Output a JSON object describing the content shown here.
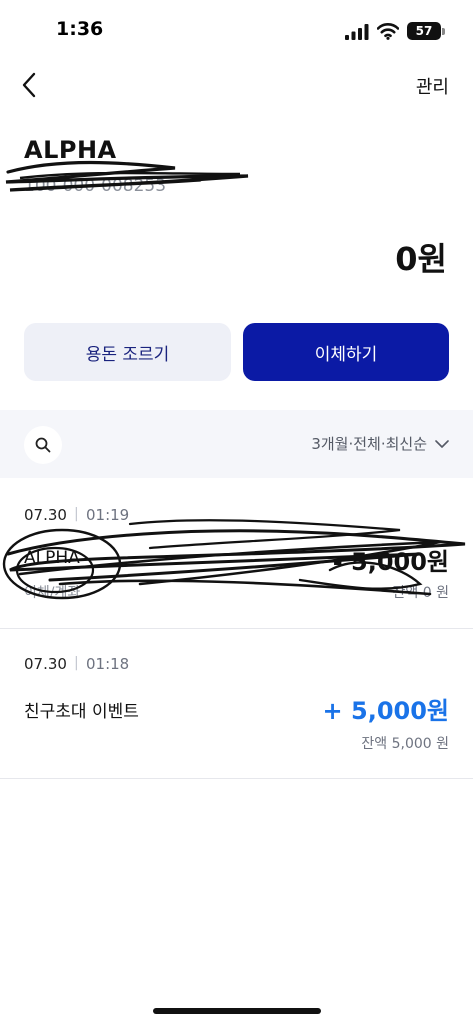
{
  "status_bar": {
    "time": "1:36",
    "battery": "57"
  },
  "nav": {
    "back_icon": "chevron-left-icon",
    "manage_label": "관리"
  },
  "account": {
    "name": "ALPHA",
    "number": "100-000-008253"
  },
  "balance": {
    "amount": "0원"
  },
  "actions": {
    "allowance_label": "용돈 조르기",
    "transfer_label": "이체하기"
  },
  "filter": {
    "search_icon": "search-icon",
    "label": "3개월·전체·최신순",
    "chevron_icon": "chevron-down-icon"
  },
  "transactions": [
    {
      "date": "07.30",
      "separator": "|",
      "time": "01:19",
      "title": "ALPHA",
      "sub": "이체/계좌",
      "amount": "- 5,000원",
      "balance": "잔액 0 원",
      "redacted": true
    },
    {
      "date": "07.30",
      "separator": "|",
      "time": "01:18",
      "title": "친구초대 이벤트",
      "amount": "+ 5,000원",
      "balance": "잔액 5,000 원",
      "amount_color": "#1a73e8"
    }
  ]
}
